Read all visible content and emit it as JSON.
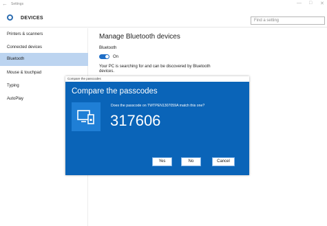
{
  "window": {
    "title": "Settings",
    "back_glyph": "←",
    "minimize_glyph": "—",
    "maximize_glyph": "□",
    "close_glyph": "✕"
  },
  "header": {
    "icon": "gear-icon",
    "title": "DEVICES",
    "search_placeholder": "Find a setting"
  },
  "sidebar": {
    "items": [
      {
        "label": "Printers & scanners"
      },
      {
        "label": "Connected devices"
      },
      {
        "label": "Bluetooth"
      },
      {
        "label": "Mouse & touchpad"
      },
      {
        "label": "Typing"
      },
      {
        "label": "AutoPlay"
      }
    ]
  },
  "main": {
    "heading": "Manage Bluetooth devices",
    "bluetooth_label": "Bluetooth",
    "toggle_label": "On",
    "description": "Your PC is searching for and can be discovered by Bluetooth devices."
  },
  "dialog": {
    "title": "Compare the passcodes",
    "heading": "Compare the passcodes",
    "question": "Does the passcode on TWTPEN1307059A match this one?",
    "code": "317606",
    "icon": "devices-icon",
    "buttons": {
      "yes": "Yes",
      "no": "No",
      "cancel": "Cancel"
    }
  },
  "colors": {
    "accent": "#1f6ec7",
    "dialog_bg": "#0a64b8",
    "selected_item": "#bcd4f0"
  }
}
